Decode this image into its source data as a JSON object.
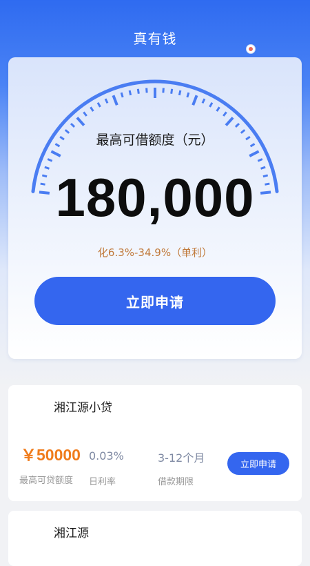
{
  "header": {
    "title": "真有钱"
  },
  "hero": {
    "limit_label": "最高可借额度（元）",
    "limit_amount": "180,000",
    "rate_note": "化6.3%-34.9%（单利）",
    "apply_label": "立即申请"
  },
  "products": [
    {
      "name": "湘江源小贷",
      "amount": "￥50000",
      "amount_label": "最高可贷额度",
      "rate": "0.03%",
      "rate_label": "日利率",
      "term": "3-12个月",
      "term_label": "借款期限",
      "apply_label": "立即申请"
    },
    {
      "name": "湘江源"
    }
  ],
  "colors": {
    "primary": "#3466ef",
    "header_blue": "#2f6bf0",
    "amount_orange": "#f07c1c",
    "rate_note_orange": "#c0793a",
    "gauge_blue": "#4a7df2"
  },
  "icons": {
    "floating_badge": "coin-badge-icon"
  }
}
